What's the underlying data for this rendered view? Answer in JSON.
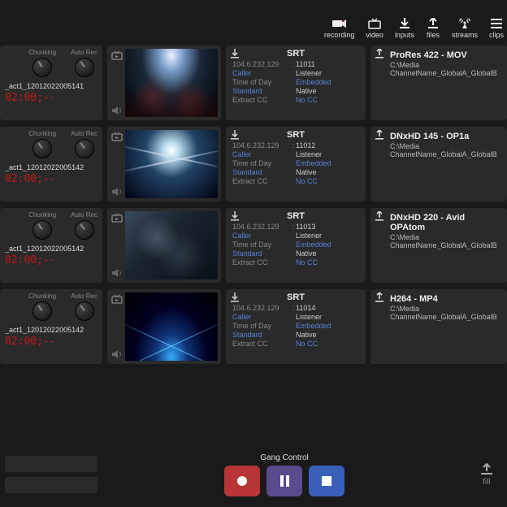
{
  "topbar": [
    {
      "icon": "camera",
      "label": "recording"
    },
    {
      "icon": "tv",
      "label": "video"
    },
    {
      "icon": "download",
      "label": "inputs"
    },
    {
      "icon": "upload",
      "label": "files"
    },
    {
      "icon": "antenna",
      "label": "streams"
    },
    {
      "icon": "list",
      "label": "clips"
    }
  ],
  "knob_labels": {
    "chunking": "Chunking",
    "autorec": "Auto Rec"
  },
  "rows": [
    {
      "name": "_act1_12012022005141",
      "tc": "02:00;--",
      "srt": {
        "title": "SRT",
        "ip": "104.6.232.129",
        "port": "11011",
        "mode_k": "Caller",
        "mode_v": "Listener",
        "tod_k": "Time of Day",
        "tod_v": "Embedded",
        "res_k": "Standard",
        "res_v": "Native",
        "cc_k": "Extract CC",
        "cc_v": "No CC"
      },
      "out": {
        "title": "ProRes 422 - MOV",
        "path": "C:\\Media",
        "file": "ChannelName_GlobalA_GlobalB"
      }
    },
    {
      "name": "_act1_12012022005142",
      "tc": "02:00;--",
      "srt": {
        "title": "SRT",
        "ip": "104.6.232.129",
        "port": "11012",
        "mode_k": "Caller",
        "mode_v": "Listener",
        "tod_k": "Time of Day",
        "tod_v": "Embedded",
        "res_k": "Standard",
        "res_v": "Native",
        "cc_k": "Extract CC",
        "cc_v": "No CC"
      },
      "out": {
        "title": "DNxHD 145 - OP1a",
        "path": "C:\\Media",
        "file": "ChannelName_GlobalA_GlobalB"
      }
    },
    {
      "name": "_act1_12012022005142",
      "tc": "02:00;--",
      "srt": {
        "title": "SRT",
        "ip": "104.6.232.129",
        "port": "11013",
        "mode_k": "Caller",
        "mode_v": "Listener",
        "tod_k": "Time of Day",
        "tod_v": "Embedded",
        "res_k": "Standard",
        "res_v": "Native",
        "cc_k": "Extract CC",
        "cc_v": "No CC"
      },
      "out": {
        "title": "DNxHD 220 - Avid OPAtom",
        "path": "C:\\Media",
        "file": "ChannelName_GlobalA_GlobalB"
      }
    },
    {
      "name": "_act1_12012022005142",
      "tc": "02:00;--",
      "srt": {
        "title": "SRT",
        "ip": "104.6.232.129",
        "port": "11014",
        "mode_k": "Caller",
        "mode_v": "Listener",
        "tod_k": "Time of Day",
        "tod_v": "Embedded",
        "res_k": "Standard",
        "res_v": "Native",
        "cc_k": "Extract CC",
        "cc_v": "No CC"
      },
      "out": {
        "title": "H264 - MP4",
        "path": "C:\\Media",
        "file": "ChannelName_GlobalA_GlobalB"
      }
    }
  ],
  "footer": {
    "gang": "Gang Control",
    "fill": "fill"
  }
}
